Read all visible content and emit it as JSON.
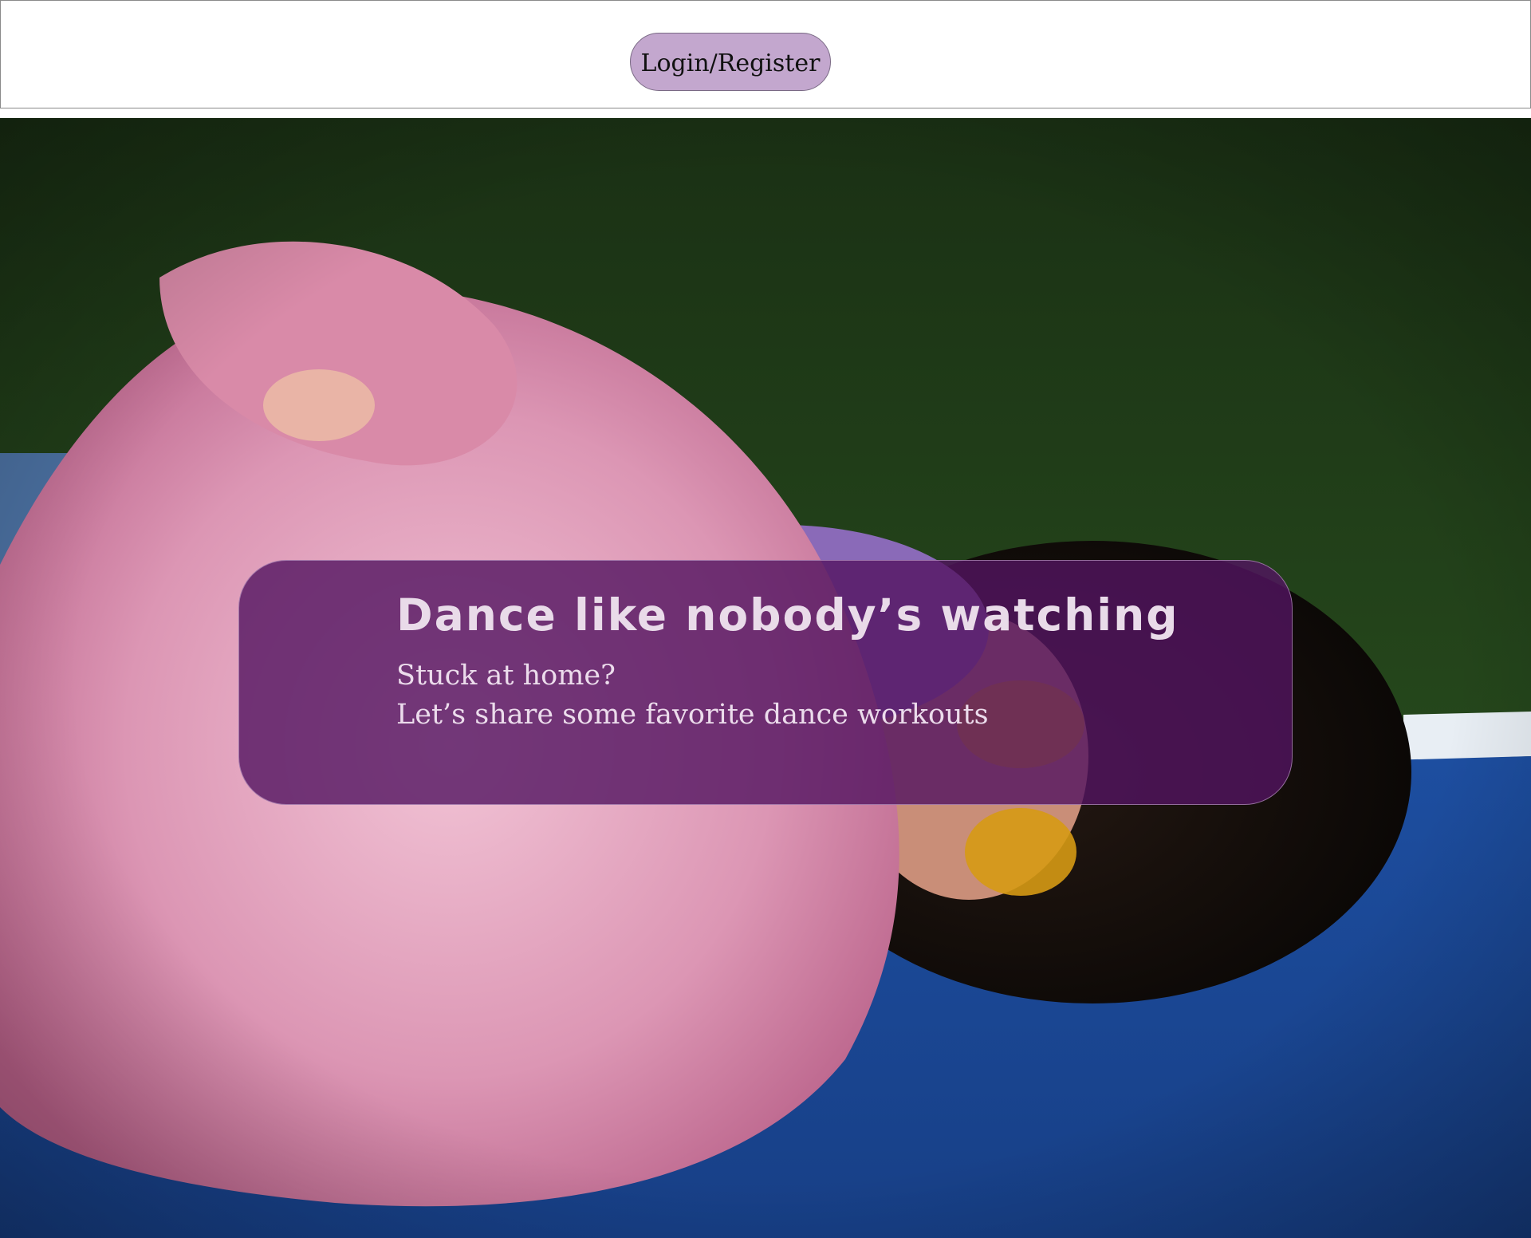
{
  "header": {
    "login_label": "Login/Register"
  },
  "hero": {
    "image_description": "dancer-in-pink-fur-coat-lying-on-court",
    "headline": "Dance like nobody’s watching",
    "subtitle_line1": "Stuck at home?",
    "subtitle_line2": "Let’s share some favorite dance workouts"
  },
  "colors": {
    "button_bg": "#c3a7ce",
    "overlay_bg": "#521460",
    "court_green": "#2a4f1f",
    "court_blue": "#1f4a98",
    "fur_pink": "#e7a9c2"
  }
}
